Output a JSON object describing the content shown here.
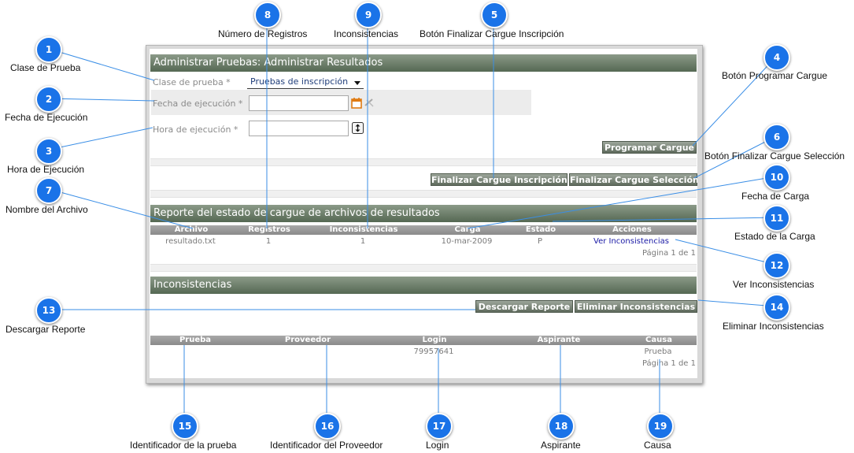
{
  "admin": {
    "title": "Administrar Pruebas: Administrar Resultados",
    "clase_label": "Clase de prueba *",
    "clase_value": "Pruebas de inscripción",
    "fecha_label": "Fecha de ejecución *",
    "hora_label": "Hora de ejecución *",
    "programar_button": "Programar Cargue",
    "finalizar_inscripcion_button": "Finalizar Cargue Inscripción",
    "finalizar_seleccion_button": "Finalizar Cargue Selección"
  },
  "reporte": {
    "title": "Reporte del estado de cargue de archivos de resultados",
    "columns": [
      "Archivo",
      "Registros",
      "Inconsistencias",
      "Carga",
      "Estado",
      "Acciones"
    ],
    "rows": [
      {
        "archivo": "resultado.txt",
        "registros": "1",
        "inconsistencias": "1",
        "carga": "10-mar-2009",
        "estado": "P",
        "accion": "Ver Inconsistencias"
      }
    ],
    "pager": "Página 1 de 1"
  },
  "inconsistencias": {
    "title": "Inconsistencias",
    "descargar_button": "Descargar Reporte",
    "eliminar_button": "Eliminar Inconsistencias",
    "columns": [
      "Prueba",
      "Proveedor",
      "Login",
      "Aspirante",
      "Causa"
    ],
    "rows": [
      {
        "prueba": "",
        "proveedor": "",
        "login": "79957641",
        "aspirante": "",
        "causa": "Prueba"
      }
    ],
    "pager": "Página 1 de 1"
  },
  "annotations": [
    {
      "number": "1",
      "label": "Clase de Prueba"
    },
    {
      "number": "2",
      "label": "Fecha de Ejecución"
    },
    {
      "number": "3",
      "label": "Hora de Ejecución"
    },
    {
      "number": "4",
      "label": "Botón Programar Cargue"
    },
    {
      "number": "5",
      "label": "Botón Finalizar Cargue Inscripción"
    },
    {
      "number": "6",
      "label": "Botón Finalizar Cargue Selección"
    },
    {
      "number": "7",
      "label": "Nombre del Archivo"
    },
    {
      "number": "8",
      "label": "Número de Registros"
    },
    {
      "number": "9",
      "label": "Inconsistencias"
    },
    {
      "number": "10",
      "label": "Fecha de Carga"
    },
    {
      "number": "11",
      "label": "Estado de la Carga"
    },
    {
      "number": "12",
      "label": "Ver Inconsistencias"
    },
    {
      "number": "13",
      "label": "Descargar Reporte"
    },
    {
      "number": "14",
      "label": "Eliminar Inconsistencias"
    },
    {
      "number": "15",
      "label": "Identificador de la prueba"
    },
    {
      "number": "16",
      "label": "Identificador del Proveedor"
    },
    {
      "number": "17",
      "label": "Login"
    },
    {
      "number": "18",
      "label": "Aspirante"
    },
    {
      "number": "19",
      "label": "Causa"
    }
  ],
  "colors": {
    "badge": "#1a73e8",
    "header_green": "#6f806c",
    "button": "#7a8578",
    "link": "#1a1aa6"
  }
}
